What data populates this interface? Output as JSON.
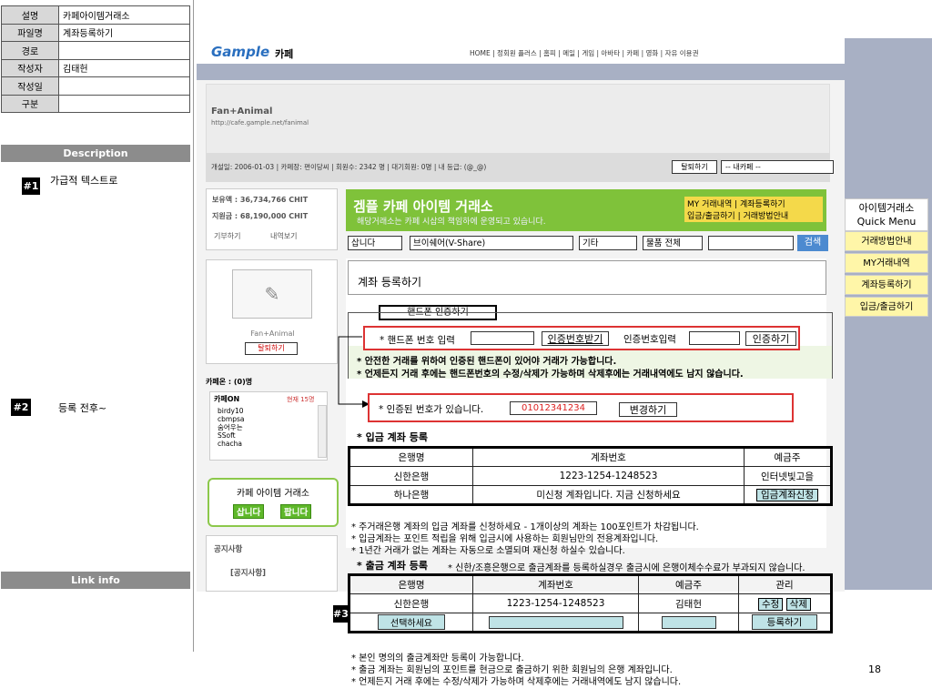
{
  "spec": [
    {
      "k": "설명",
      "v": "카페아이템거래소"
    },
    {
      "k": "파일명",
      "v": "계좌등록하기"
    },
    {
      "k": "경로",
      "v": ""
    },
    {
      "k": "작성자",
      "v": "김태헌"
    },
    {
      "k": "작성일",
      "v": ""
    },
    {
      "k": "구분",
      "v": ""
    }
  ],
  "description_label": "Description",
  "link_info_label": "Link info",
  "annotations": [
    {
      "marker": "#1",
      "text": "가급적 텍스트로"
    },
    {
      "marker": "#2",
      "text": "등록 전후~"
    }
  ],
  "marker3": "#3",
  "page_number": "18",
  "logo": "Gample",
  "logo_sub": "카페",
  "topnav_text": "HOME | 정회원 플러스 | 홈피 | 메일 | 게임 | 아바타 | 카페 | 영화 | 자유 이용권",
  "cafe": {
    "name": "Fan+Animal",
    "url": "http://cafe.gample.net/fanimal",
    "info": "개설일: 2006-01-03 | 카페장: 편이당씨 | 회원수: 2342 명 | 대기회원: 0명 | 내 등급: (@_@)",
    "leave_btn": "탈퇴하기",
    "my_cafe": "-- 내카페 --"
  },
  "left": {
    "money": "보유액 : 36,734,766 CHIT",
    "support": "지원금 : 68,190,000 CHIT",
    "donate": "기부하기",
    "history": "내역보기",
    "profile_name": "Fan+Animal",
    "profile_leave": "탈퇴하기",
    "online": "카페온 : (0)명",
    "on_title": "카페ON",
    "on_count": "현재 15명",
    "members": [
      "birdy10",
      "cbmpsa",
      "숨어우는",
      "SSoft",
      "chacha"
    ],
    "exchange_title": "카페 아이템 거래소",
    "buy": "삽니다",
    "sell": "팝니다",
    "notice": "공지사항",
    "notice_item": "[공지사항]"
  },
  "title": {
    "main": "겜플 카페 아이템 거래소",
    "sub": "해당거래소는 카페 시삽의 책임하에 운영되고 있습니다.",
    "link1": "MY 거래내역 | 계좌등록하기",
    "link2": "입금/출금하기 | 거래방법안내"
  },
  "filters": {
    "f1": "삽니다",
    "f2": "브이쉐어(V-Share)",
    "f3": "기타",
    "f4": "물품 전체",
    "search_btn": "검색"
  },
  "page_heading": "계좌 등록하기",
  "phone": {
    "tab": "핸드폰 인증하기",
    "label": "* 핸드폰 번호 입력",
    "get_code": "인증번호받기",
    "code_label": "인증번호입력",
    "verify": "인증하기",
    "note1": "* 안전한 거래를 위하여 인증된 핸드폰이 있어야 거래가 가능합니다.",
    "note2": "* 언제든지 거래 후에는 핸드폰번호의 수정/삭제가 가능하며 삭제후에는 거래내역에도 남지 않습니다.",
    "verified_label": "* 인증된 번호가 있습니다.",
    "verified_number": "01012341234",
    "change": "변경하기"
  },
  "deposit": {
    "title": "* 입금 계좌 등록",
    "headers": [
      "은행명",
      "계좌번호",
      "예금주"
    ],
    "rows": [
      [
        "신한은행",
        "1223-1254-1248523",
        "인터넷빛고을"
      ],
      [
        "하나은행",
        "미신청 계좌입니다. 지금 신청하세요",
        "입금계좌신청"
      ]
    ],
    "notes": [
      "* 주거래은행 계좌의 입금 계좌를 신청하세요 - 1개이상의 계좌는 100포인트가 차감됩니다.",
      "* 입금계좌는 포인트 적립을 위해 입금시에 사용하는 회원님만의 전용계좌입니다.",
      "* 1년간 거래가 없는 계좌는 자동으로 소멸되며 재신청 하실수 있습니다."
    ]
  },
  "withdraw": {
    "title": "* 출금 계좌 등록",
    "desc": "* 신한/조흥은행으로 출금계좌를 등록하실경우 출금시에 은행이체수수료가 부과되지 않습니다.",
    "headers": [
      "은행명",
      "계좌번호",
      "예금주",
      "관리"
    ],
    "row": [
      "신한은행",
      "1223-1254-1248523",
      "김태헌"
    ],
    "edit": "수정",
    "del": "삭제",
    "select": "선택하세요",
    "register": "등록하기"
  },
  "bottom_notes": [
    "* 본인 명의의 출금계좌만 등록이 가능합니다.",
    "* 출금 계좌는 회원님의 포인트를 현금으로 출금하기 위한 회원님의 은행 계좌입니다.",
    "* 언제든지 거래 후에는 수정/삭제가 가능하며 삭제후에는 거래내역에도 남지 않습니다."
  ],
  "quick": {
    "title1": "아이템거래소",
    "title2": "Quick Menu",
    "items": [
      "거래방법안내",
      "MY거래내역",
      "계좌등록하기",
      "입금/출금하기"
    ]
  }
}
